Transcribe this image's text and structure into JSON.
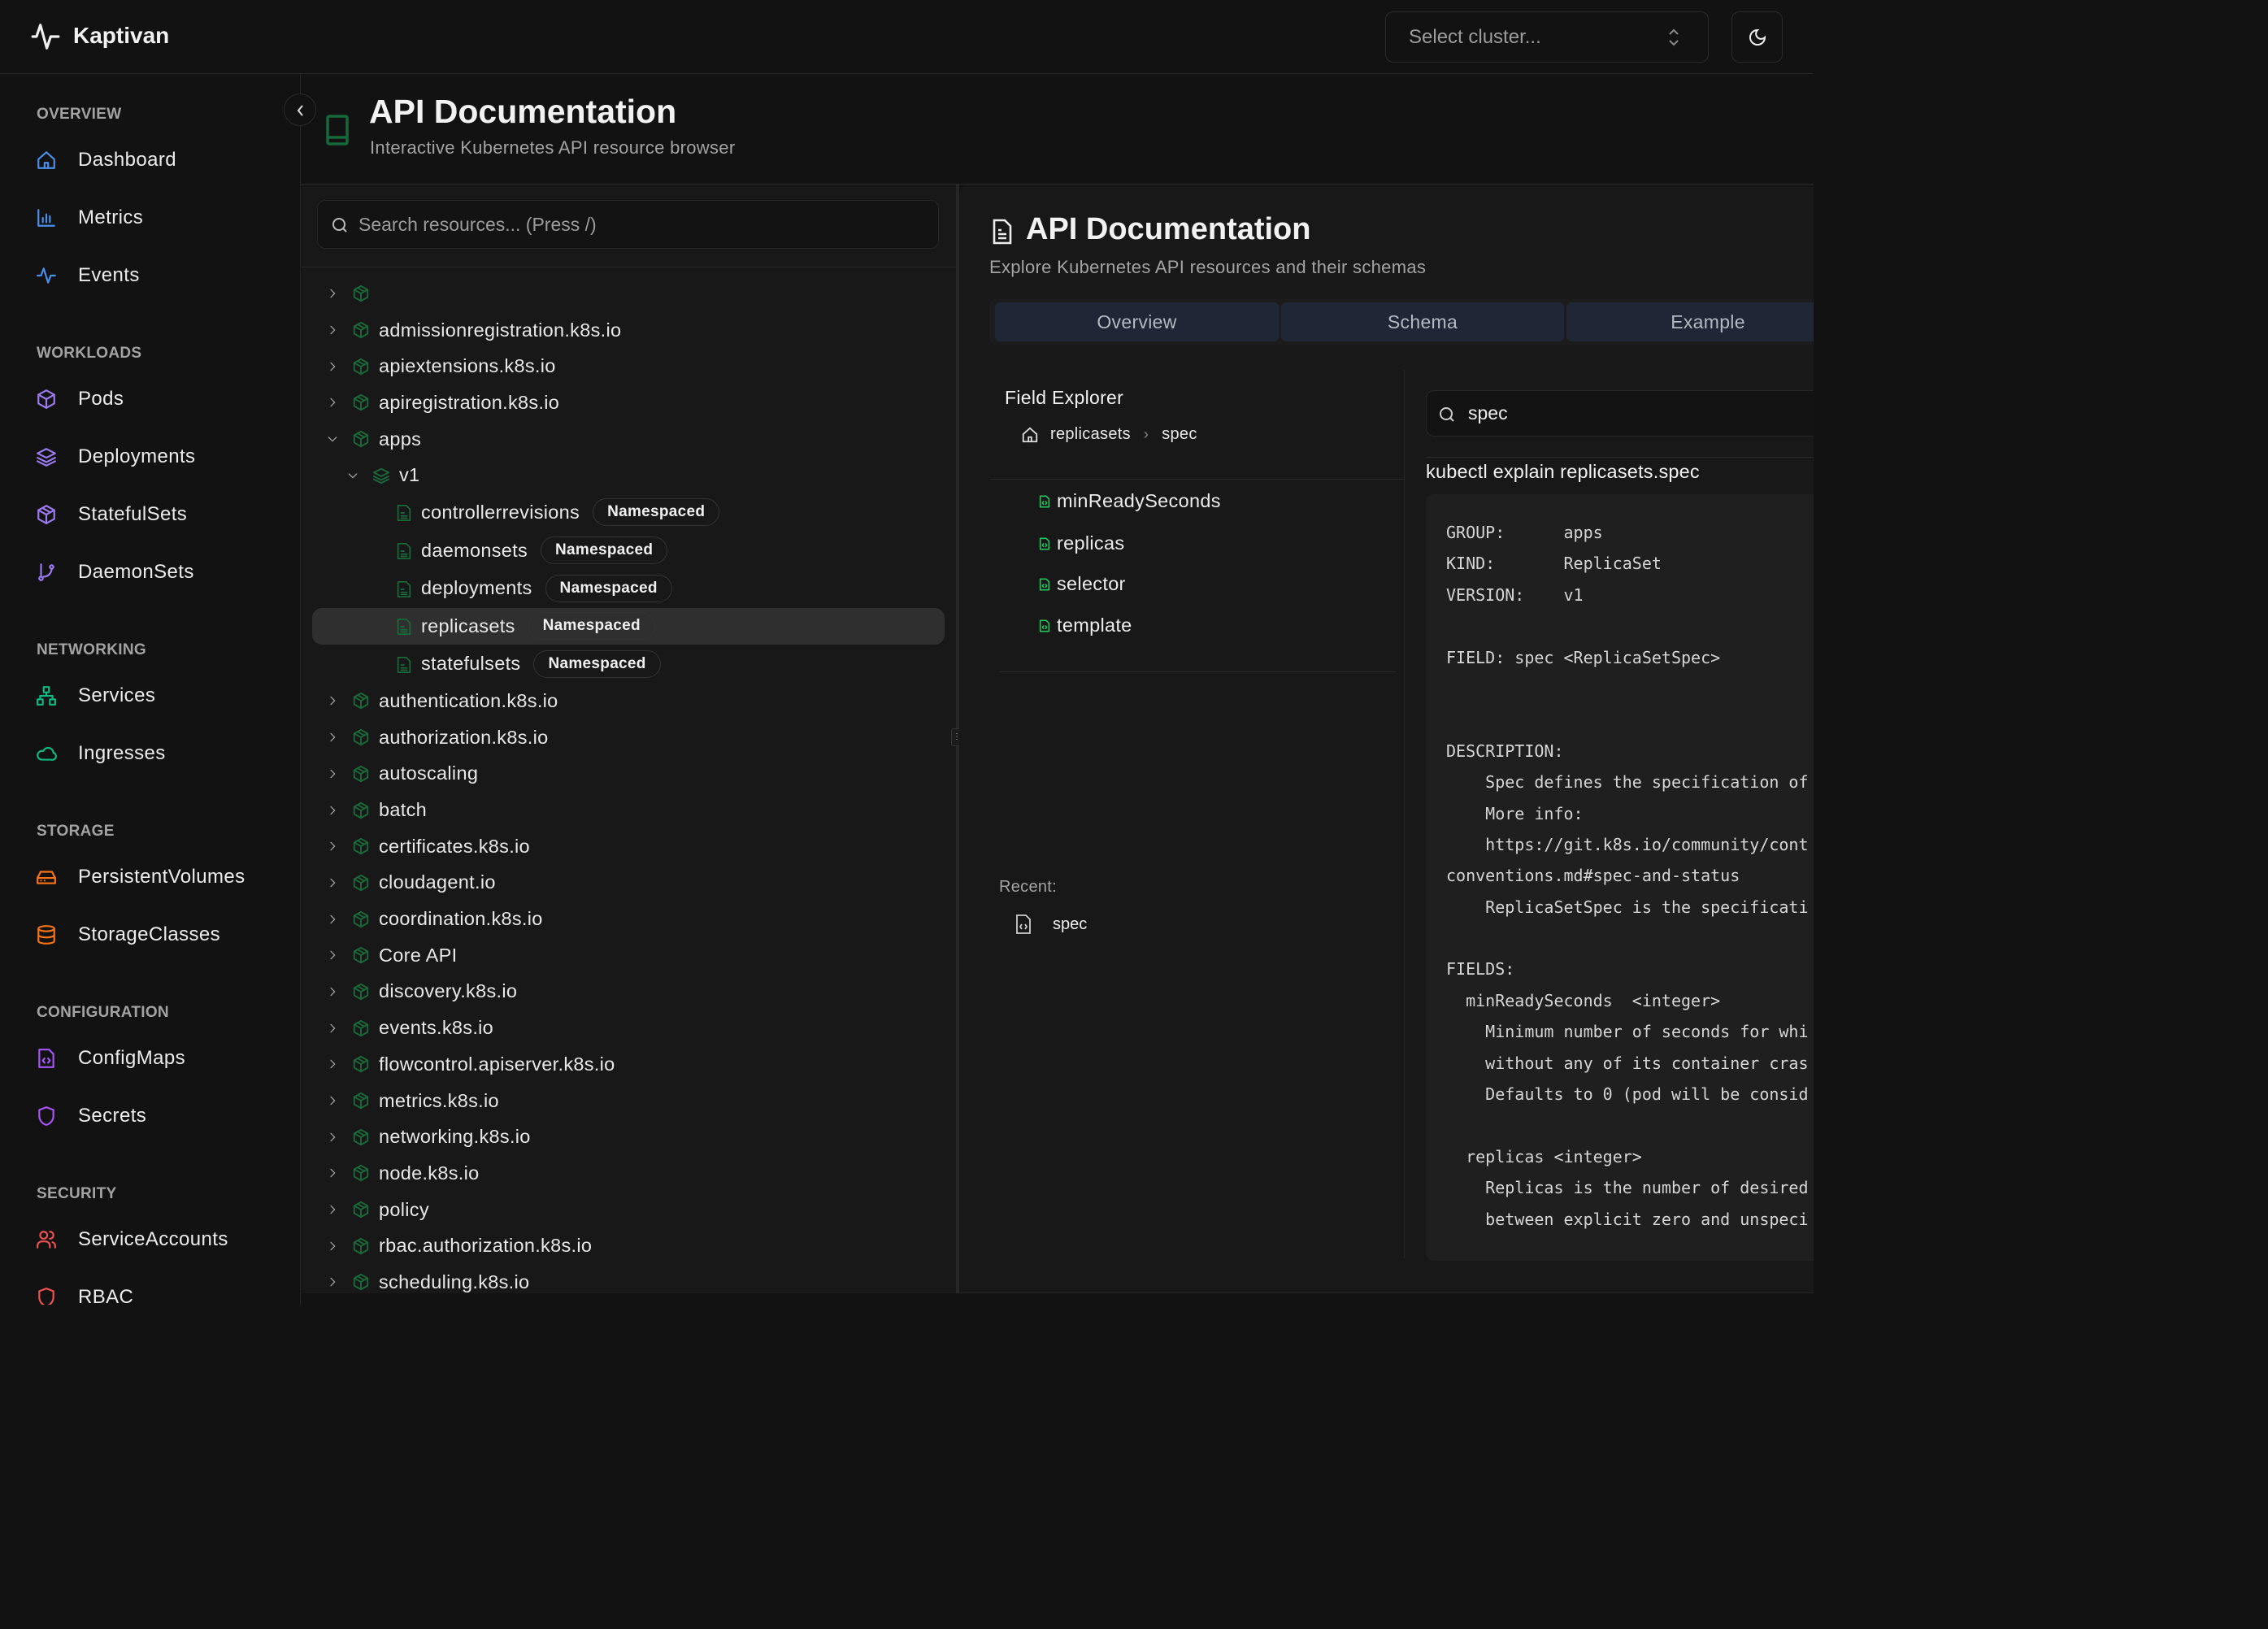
{
  "app": {
    "title": "Kaptivan",
    "logo_icon": "activity-icon"
  },
  "header": {
    "cluster_placeholder": "Select cluster...",
    "theme_icon": "moon-icon"
  },
  "colors": {
    "overview": "#4a8fe8",
    "workloads": "#9b7cf0",
    "networking": "#10b981",
    "storage": "#f97316",
    "configuration": "#a855f7",
    "security": "#f05252",
    "tree_icon": "#1a6b3c",
    "field_icon": "#22c55e",
    "tab_bg": "#1f2737"
  },
  "sidebar": {
    "sections": [
      {
        "label": "OVERVIEW",
        "color_key": "overview",
        "items": [
          {
            "label": "Dashboard",
            "icon": "home"
          },
          {
            "label": "Metrics",
            "icon": "chart"
          },
          {
            "label": "Events",
            "icon": "activity"
          }
        ]
      },
      {
        "label": "WORKLOADS",
        "color_key": "workloads",
        "items": [
          {
            "label": "Pods",
            "icon": "box"
          },
          {
            "label": "Deployments",
            "icon": "layers"
          },
          {
            "label": "StatefulSets",
            "icon": "package"
          },
          {
            "label": "DaemonSets",
            "icon": "git-branch"
          }
        ]
      },
      {
        "label": "NETWORKING",
        "color_key": "networking",
        "items": [
          {
            "label": "Services",
            "icon": "network"
          },
          {
            "label": "Ingresses",
            "icon": "cloud"
          }
        ]
      },
      {
        "label": "STORAGE",
        "color_key": "storage",
        "items": [
          {
            "label": "PersistentVolumes",
            "icon": "hard-drive"
          },
          {
            "label": "StorageClasses",
            "icon": "database"
          }
        ]
      },
      {
        "label": "CONFIGURATION",
        "color_key": "configuration",
        "items": [
          {
            "label": "ConfigMaps",
            "icon": "file-code"
          },
          {
            "label": "Secrets",
            "icon": "shield"
          }
        ]
      },
      {
        "label": "SECURITY",
        "color_key": "security",
        "items": [
          {
            "label": "ServiceAccounts",
            "icon": "users"
          },
          {
            "label": "RBAC",
            "icon": "shield"
          }
        ]
      }
    ]
  },
  "page": {
    "title": "API Documentation",
    "subtitle": "Interactive Kubernetes API resource browser"
  },
  "tree": {
    "search_placeholder": "Search resources... (Press /)",
    "rows": [
      {
        "label": "",
        "level": 0,
        "type": "group",
        "expanded": false
      },
      {
        "label": "admissionregistration.k8s.io",
        "level": 0,
        "type": "group",
        "expanded": false
      },
      {
        "label": "apiextensions.k8s.io",
        "level": 0,
        "type": "group",
        "expanded": false
      },
      {
        "label": "apiregistration.k8s.io",
        "level": 0,
        "type": "group",
        "expanded": false
      },
      {
        "label": "apps",
        "level": 0,
        "type": "group",
        "expanded": true
      },
      {
        "label": "v1",
        "level": 1,
        "type": "version",
        "expanded": true
      },
      {
        "label": "controllerrevisions",
        "level": 2,
        "type": "resource",
        "badge": "Namespaced"
      },
      {
        "label": "daemonsets",
        "level": 2,
        "type": "resource",
        "badge": "Namespaced"
      },
      {
        "label": "deployments",
        "level": 2,
        "type": "resource",
        "badge": "Namespaced"
      },
      {
        "label": "replicasets",
        "level": 2,
        "type": "resource",
        "badge": "Namespaced",
        "selected": true
      },
      {
        "label": "statefulsets",
        "level": 2,
        "type": "resource",
        "badge": "Namespaced"
      },
      {
        "label": "authentication.k8s.io",
        "level": 0,
        "type": "group",
        "expanded": false
      },
      {
        "label": "authorization.k8s.io",
        "level": 0,
        "type": "group",
        "expanded": false
      },
      {
        "label": "autoscaling",
        "level": 0,
        "type": "group",
        "expanded": false
      },
      {
        "label": "batch",
        "level": 0,
        "type": "group",
        "expanded": false
      },
      {
        "label": "certificates.k8s.io",
        "level": 0,
        "type": "group",
        "expanded": false
      },
      {
        "label": "cloudagent.io",
        "level": 0,
        "type": "group",
        "expanded": false
      },
      {
        "label": "coordination.k8s.io",
        "level": 0,
        "type": "group",
        "expanded": false
      },
      {
        "label": "Core API",
        "level": 0,
        "type": "group",
        "expanded": false
      },
      {
        "label": "discovery.k8s.io",
        "level": 0,
        "type": "group",
        "expanded": false
      },
      {
        "label": "events.k8s.io",
        "level": 0,
        "type": "group",
        "expanded": false
      },
      {
        "label": "flowcontrol.apiserver.k8s.io",
        "level": 0,
        "type": "group",
        "expanded": false
      },
      {
        "label": "metrics.k8s.io",
        "level": 0,
        "type": "group",
        "expanded": false
      },
      {
        "label": "networking.k8s.io",
        "level": 0,
        "type": "group",
        "expanded": false
      },
      {
        "label": "node.k8s.io",
        "level": 0,
        "type": "group",
        "expanded": false
      },
      {
        "label": "policy",
        "level": 0,
        "type": "group",
        "expanded": false
      },
      {
        "label": "rbac.authorization.k8s.io",
        "level": 0,
        "type": "group",
        "expanded": false
      },
      {
        "label": "scheduling.k8s.io",
        "level": 0,
        "type": "group",
        "expanded": false
      }
    ]
  },
  "doc": {
    "title": "API Documentation",
    "subtitle": "Explore Kubernetes API resources and their schemas",
    "tabs": [
      {
        "label": "Overview"
      },
      {
        "label": "Schema"
      },
      {
        "label": "Example"
      }
    ],
    "field_explorer": {
      "title": "Field Explorer",
      "breadcrumb": [
        "replicasets",
        "spec"
      ],
      "fields": [
        "minReadySeconds",
        "replicas",
        "selector",
        "template"
      ],
      "recent_label": "Recent:",
      "recent": [
        "spec"
      ]
    },
    "search_value": "spec",
    "command": "kubectl explain replicasets.spec",
    "code": {
      "lines": [
        "GROUP:      apps",
        "KIND:       ReplicaSet",
        "VERSION:    v1",
        "",
        "FIELD: spec <ReplicaSetSpec>",
        "",
        "",
        "DESCRIPTION:",
        "    Spec defines the specification of",
        "    More info:",
        "    https://git.k8s.io/community/cont",
        "conventions.md#spec-and-status",
        "    ReplicaSetSpec is the specificati",
        "",
        "FIELDS:",
        "  minReadySeconds  <integer>",
        "    Minimum number of seconds for whi",
        "    without any of its container cras",
        "    Defaults to 0 (pod will be consid",
        "",
        "  replicas <integer>",
        "    Replicas is the number of desired",
        "    between explicit zero and unspeci"
      ]
    }
  }
}
